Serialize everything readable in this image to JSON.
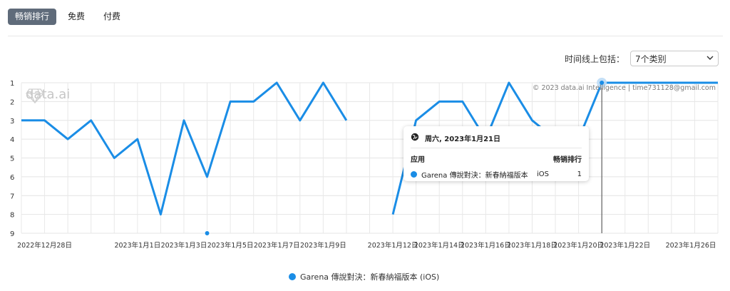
{
  "tabs": [
    {
      "label": "畅销排行",
      "active": true
    },
    {
      "label": "免费",
      "active": false
    },
    {
      "label": "付费",
      "active": false
    }
  ],
  "filter": {
    "label": "时间线上包括：",
    "value": "7个类别"
  },
  "watermark": {
    "logo_text": "data.ai",
    "copyright": "© 2023 data.ai Intelligence | time731128@gmail.com"
  },
  "colors": {
    "series": "#1a8de6",
    "tab_active": "#5f6b7a"
  },
  "tooltip": {
    "date": "周六, 2023年1月21日",
    "col_app": "应用",
    "col_rank": "畅销排行",
    "app": "Garena 傳說對決：新春納福版本",
    "platform": "iOS",
    "rank": "1"
  },
  "legend": {
    "label": "Garena 傳說對決：新春納福版本 (iOS)"
  },
  "chart_data": {
    "type": "line",
    "y_axis": {
      "reversed": true,
      "ylim": [
        1,
        9
      ],
      "ticks": [
        "1",
        "2",
        "3",
        "4",
        "5",
        "6",
        "7",
        "8",
        "9"
      ]
    },
    "x_tick_labels": [
      "2022年12月28日",
      "2023年1月1日",
      "2023年1月3日",
      "2023年1月5日",
      "2023年1月7日",
      "2023年1月9日",
      "2023年1月12日",
      "2023年1月14日",
      "2023年1月16日",
      "2023年1月18日",
      "2023年1月20日",
      "2023年1月22日",
      "2023年1月26日"
    ],
    "series": [
      {
        "name": "Garena 傳說對決：新春納福版本 (iOS)",
        "x": [
          "2022-12-27",
          "2022-12-28",
          "2022-12-29",
          "2022-12-30",
          "2022-12-31",
          "2023-01-01",
          "2023-01-02",
          "2023-01-03",
          "2023-01-04",
          "2023-01-05",
          "2023-01-06",
          "2023-01-07",
          "2023-01-08",
          "2023-01-09",
          "2023-01-10",
          "2023-01-11",
          "2023-01-12",
          "2023-01-13",
          "2023-01-14",
          "2023-01-15",
          "2023-01-16",
          "2023-01-17",
          "2023-01-18",
          "2023-01-19",
          "2023-01-20",
          "2023-01-21",
          "2023-01-22",
          "2023-01-23",
          "2023-01-24",
          "2023-01-25",
          "2023-01-26"
        ],
        "values": [
          3,
          3,
          4,
          3,
          5,
          4,
          8,
          3,
          6,
          2,
          2,
          1,
          3,
          1,
          3,
          null,
          8,
          3,
          2,
          2,
          4,
          1,
          3,
          4,
          4,
          1,
          1,
          1,
          1,
          1,
          1
        ]
      }
    ],
    "isolated_points": [
      {
        "x": "2023-01-04",
        "y": 9
      }
    ],
    "highlight": {
      "x": "2023-01-21",
      "y": 1
    }
  }
}
